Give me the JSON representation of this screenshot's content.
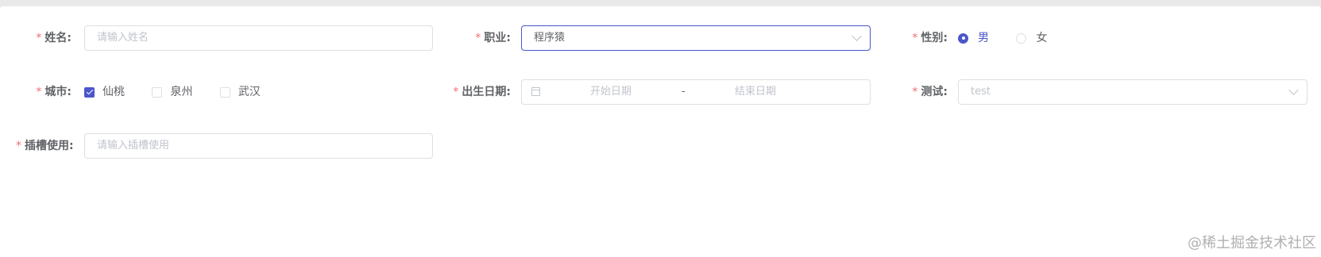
{
  "form": {
    "name": {
      "label": "姓名:",
      "placeholder": "请输入姓名"
    },
    "job": {
      "label": "职业:",
      "value": "程序猿"
    },
    "gender": {
      "label": "性别:",
      "options": [
        "男",
        "女"
      ],
      "selected": "男"
    },
    "city": {
      "label": "城市:",
      "options": [
        "仙桃",
        "泉州",
        "武汉"
      ],
      "checked": [
        "仙桃"
      ]
    },
    "birth": {
      "label": "出生日期:",
      "start_placeholder": "开始日期",
      "separator": "-",
      "end_placeholder": "结束日期"
    },
    "test": {
      "label": "测试:",
      "placeholder": "test"
    },
    "slot": {
      "label": "插槽使用:",
      "placeholder": "请输入插槽使用"
    }
  },
  "required_mark": "*",
  "watermark": "@稀土掘金技术社区",
  "colors": {
    "accent": "#4a56c9",
    "required": "#f56c6c",
    "border": "#dcdfe6"
  }
}
